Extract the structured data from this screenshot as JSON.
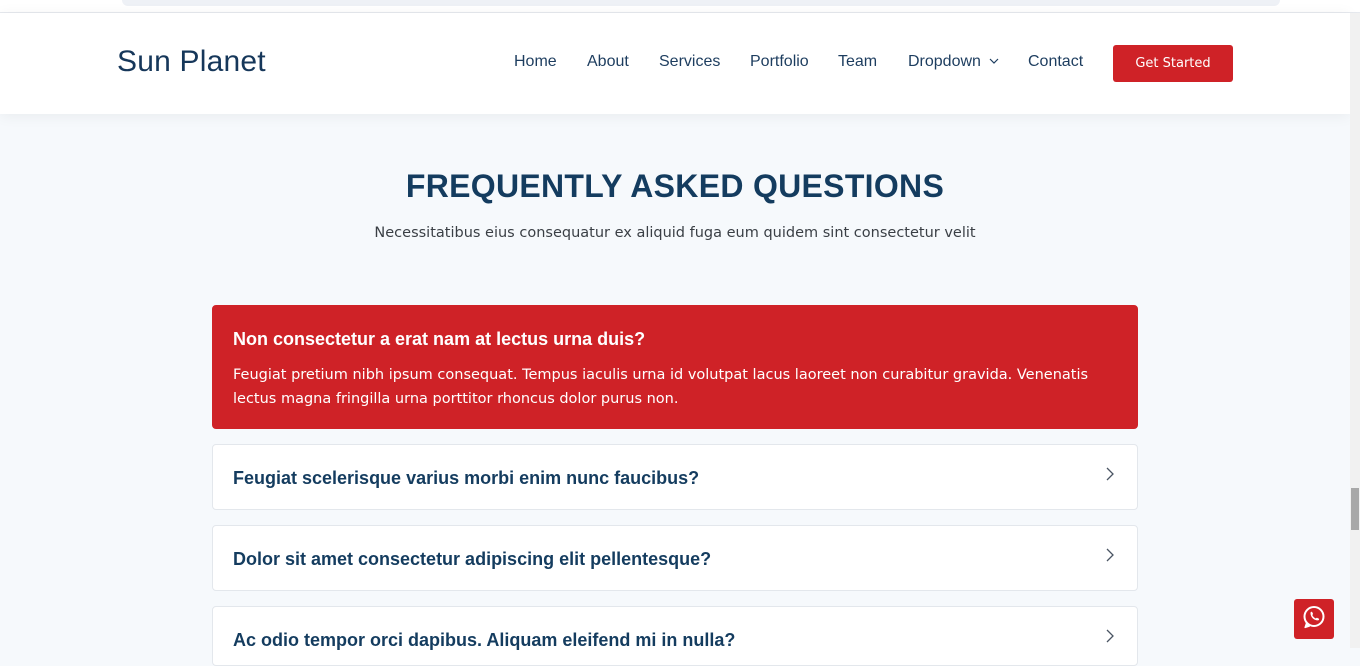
{
  "brand": {
    "name": "Sun Planet"
  },
  "nav": {
    "items": [
      {
        "label": "Home"
      },
      {
        "label": "About"
      },
      {
        "label": "Services"
      },
      {
        "label": "Portfolio"
      },
      {
        "label": "Team"
      },
      {
        "label": "Dropdown",
        "icon": "chevron-down-icon"
      },
      {
        "label": "Contact"
      }
    ],
    "cta_label": "Get Started"
  },
  "faq": {
    "title": "FREQUENTLY ASKED QUESTIONS",
    "subtitle": "Necessitatibus eius consequatur ex aliquid fuga eum quidem sint consectetur velit",
    "items": [
      {
        "question": "Non consectetur a erat nam at lectus urna duis?",
        "answer": "Feugiat pretium nibh ipsum consequat. Tempus iaculis urna id volutpat lacus laoreet non curabitur gravida. Venenatis lectus magna fringilla urna porttitor rhoncus dolor purus non.",
        "expanded": true
      },
      {
        "question": "Feugiat scelerisque varius morbi enim nunc faucibus?",
        "expanded": false
      },
      {
        "question": "Dolor sit amet consectetur adipiscing elit pellentesque?",
        "expanded": false
      },
      {
        "question": "Ac odio tempor orci dapibus. Aliquam eleifend mi in nulla?",
        "expanded": false
      }
    ]
  },
  "colors": {
    "accent": "#cf2227",
    "heading": "#143c5f",
    "background": "#f6f9fc"
  },
  "floating": {
    "icon": "whatsapp-icon"
  }
}
